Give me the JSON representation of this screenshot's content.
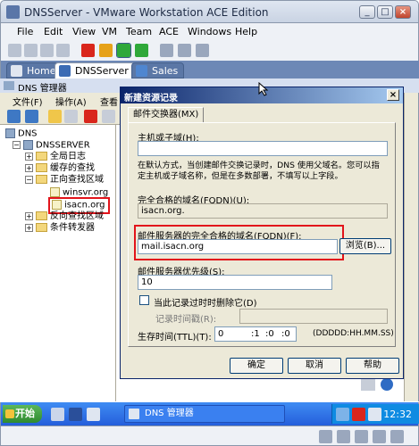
{
  "window": {
    "title": "DNSServer - VMware Workstation ACE Edition"
  },
  "menu": [
    "File",
    "Edit",
    "View",
    "VM",
    "Team",
    "ACE",
    "Windows",
    "Help"
  ],
  "tabs": [
    {
      "label": "Home"
    },
    {
      "label": "DNSServer"
    },
    {
      "label": "Sales"
    }
  ],
  "mmc": {
    "title": "DNS 管理器",
    "menu": [
      "文件(F)",
      "操作(A)",
      "查看"
    ]
  },
  "tree": {
    "root": "DNS",
    "server": "DNSSERVER",
    "global_log": "全局日志",
    "cache": "缓存的查找",
    "forward": "正向查找区域",
    "zone1": "winsvr.org",
    "zone2": "isacn.org",
    "reverse": "反向查找区域",
    "cond": "条件转发器"
  },
  "dialog": {
    "title": "新建资源记录",
    "tab": "邮件交换器(MX)",
    "host_label": "主机或子域(H):",
    "host_value": "",
    "hint_line1": "在默认方式，当创建邮件交换记录时，DNS 使用父域名。您可以指",
    "hint_line2": "定主机或子域名称，但是在多数部署，不填写以上字段。",
    "fqdn_label": "完全合格的域名(FQDN)(U):",
    "fqdn_value": "isacn.org.",
    "mailserver_label": "邮件服务器的完全合格的域名(FQDN)(F):",
    "mailserver_value": "mail.isacn.org",
    "browse": "浏览(B)...",
    "priority_label": "邮件服务器优先级(S):",
    "priority_value": "10",
    "delete_stale": "当此记录过时时删除它(D)",
    "timestamp_label": "记录时间戳(R):",
    "ttl_label": "生存时间(TTL)(T):",
    "ttl_days": "0",
    "ttl_h": ":1",
    "ttl_m": ":0",
    "ttl_s": ":0",
    "ttl_format": "(DDDDD:HH.MM.SS)",
    "ok": "确定",
    "cancel": "取消",
    "help": "帮助"
  },
  "taskbar": {
    "start": "开始",
    "task": "DNS 管理器",
    "clock": "12:32"
  }
}
